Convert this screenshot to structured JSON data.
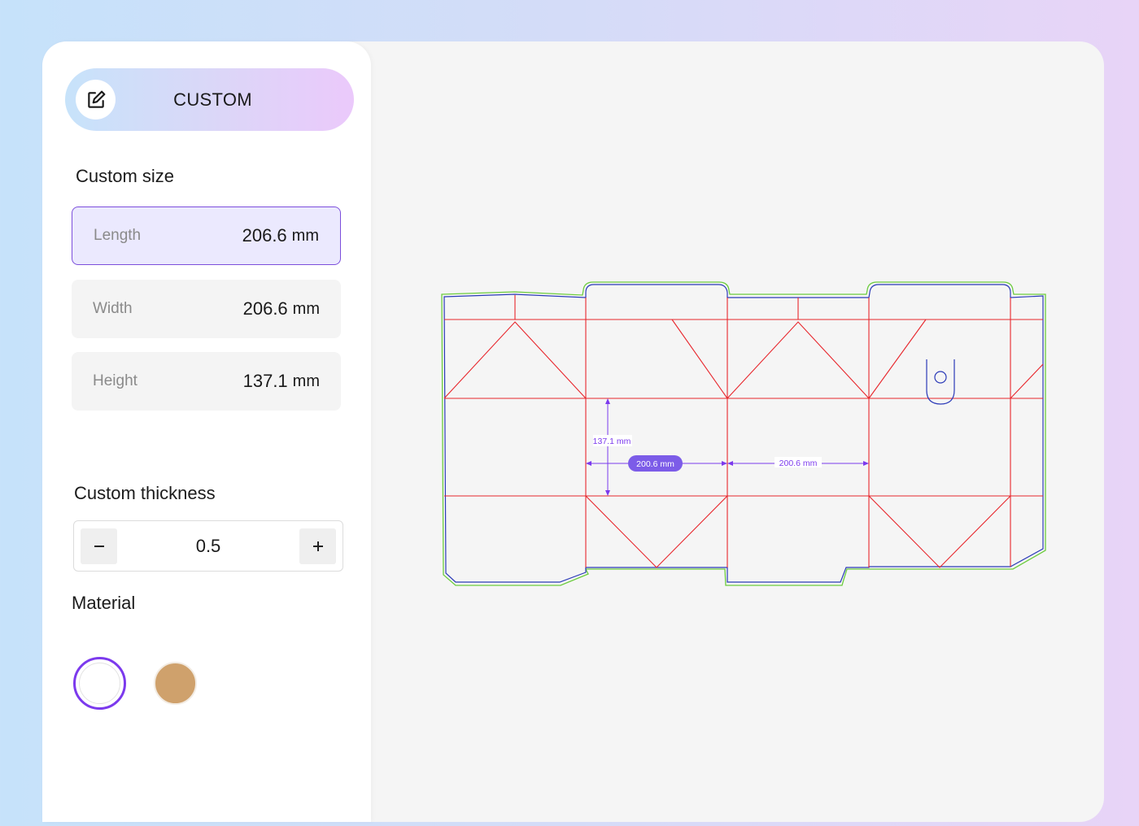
{
  "sidebar": {
    "mode": {
      "label": "CUSTOM",
      "icon": "edit-icon"
    },
    "custom_size": {
      "title": "Custom size",
      "fields": [
        {
          "label": "Length",
          "value": "206.6",
          "unit": "mm",
          "active": true
        },
        {
          "label": "Width",
          "value": "206.6",
          "unit": "mm",
          "active": false
        },
        {
          "label": "Height",
          "value": "137.1",
          "unit": "mm",
          "active": false
        }
      ]
    },
    "custom_thickness": {
      "title": "Custom thickness",
      "value": "0.5",
      "decrement_icon": "minus-icon",
      "increment_icon": "plus-icon"
    },
    "material": {
      "title": "Material",
      "options": [
        {
          "color": "#ffffff",
          "selected": true
        },
        {
          "color": "#cfa16c",
          "selected": false
        }
      ]
    }
  },
  "dieline": {
    "colors": {
      "cut": "#2b3ab8",
      "fold": "#e8262c",
      "bleed": "#6ccc3d",
      "dimension": "#7c3aed"
    },
    "height_label": "137.1 mm",
    "width_label_badge": "200.6 mm",
    "width_label": "200.6 mm"
  },
  "theme": {
    "accent": "#7c4fdc"
  }
}
